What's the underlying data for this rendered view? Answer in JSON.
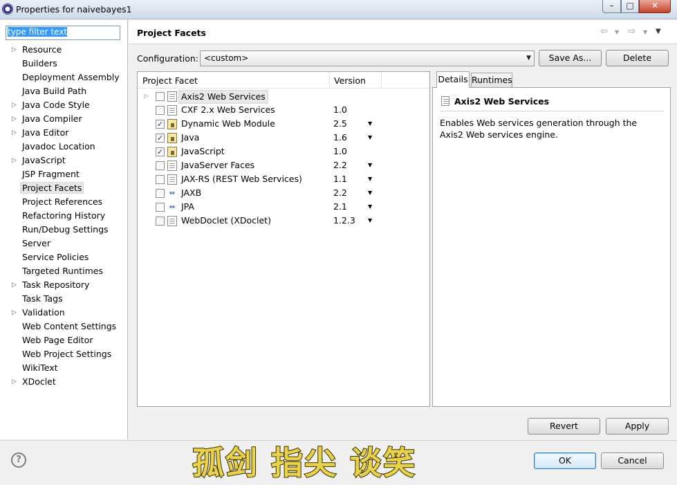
{
  "window": {
    "title": "Properties for naivebayes1",
    "controls": {
      "minimize": "–",
      "maximize": "□",
      "close": "✕"
    }
  },
  "filter": {
    "value": "type filter text"
  },
  "nav": {
    "items": [
      {
        "label": "Resource",
        "expandable": true
      },
      {
        "label": "Builders",
        "expandable": false
      },
      {
        "label": "Deployment Assembly",
        "expandable": false
      },
      {
        "label": "Java Build Path",
        "expandable": false
      },
      {
        "label": "Java Code Style",
        "expandable": true
      },
      {
        "label": "Java Compiler",
        "expandable": true
      },
      {
        "label": "Java Editor",
        "expandable": true
      },
      {
        "label": "Javadoc Location",
        "expandable": false
      },
      {
        "label": "JavaScript",
        "expandable": true
      },
      {
        "label": "JSP Fragment",
        "expandable": false
      },
      {
        "label": "Project Facets",
        "expandable": false,
        "selected": true
      },
      {
        "label": "Project References",
        "expandable": false
      },
      {
        "label": "Refactoring History",
        "expandable": false
      },
      {
        "label": "Run/Debug Settings",
        "expandable": false
      },
      {
        "label": "Server",
        "expandable": false
      },
      {
        "label": "Service Policies",
        "expandable": false
      },
      {
        "label": "Targeted Runtimes",
        "expandable": false
      },
      {
        "label": "Task Repository",
        "expandable": true
      },
      {
        "label": "Task Tags",
        "expandable": false
      },
      {
        "label": "Validation",
        "expandable": true
      },
      {
        "label": "Web Content Settings",
        "expandable": false
      },
      {
        "label": "Web Page Editor",
        "expandable": false
      },
      {
        "label": "Web Project Settings",
        "expandable": false
      },
      {
        "label": "WikiText",
        "expandable": false
      },
      {
        "label": "XDoclet",
        "expandable": true
      }
    ]
  },
  "page": {
    "title": "Project Facets",
    "configuration_label": "Configuration:",
    "configuration_value": "<custom>",
    "save_as_label": "Save As...",
    "delete_label": "Delete"
  },
  "facet_table": {
    "headers": {
      "facet": "Project Facet",
      "version": "Version"
    },
    "rows": [
      {
        "name": "Axis2 Web Services",
        "version": "",
        "checked": false,
        "icon": "page-icon",
        "expandable": true,
        "has_dropdown": false,
        "selected": true
      },
      {
        "name": "CXF 2.x Web Services",
        "version": "1.0",
        "checked": false,
        "icon": "page-icon",
        "has_dropdown": false
      },
      {
        "name": "Dynamic Web Module",
        "version": "2.5",
        "checked": true,
        "icon": "lock-page-icon",
        "has_dropdown": true
      },
      {
        "name": "Java",
        "version": "1.6",
        "checked": true,
        "icon": "lock-page-icon",
        "has_dropdown": true
      },
      {
        "name": "JavaScript",
        "version": "1.0",
        "checked": true,
        "icon": "lock-page-icon",
        "has_dropdown": false
      },
      {
        "name": "JavaServer Faces",
        "version": "2.2",
        "checked": false,
        "icon": "page-icon",
        "has_dropdown": true
      },
      {
        "name": "JAX-RS (REST Web Services)",
        "version": "1.1",
        "checked": false,
        "icon": "page-icon",
        "has_dropdown": true
      },
      {
        "name": "JAXB",
        "version": "2.2",
        "checked": false,
        "icon": "arrows-icon",
        "has_dropdown": true
      },
      {
        "name": "JPA",
        "version": "2.1",
        "checked": false,
        "icon": "arrows-icon",
        "has_dropdown": true
      },
      {
        "name": "WebDoclet (XDoclet)",
        "version": "1.2.3",
        "checked": false,
        "icon": "page-icon",
        "has_dropdown": true
      }
    ]
  },
  "details": {
    "tabs": [
      "Details",
      "Runtimes"
    ],
    "title": "Axis2 Web Services",
    "description": "Enables Web services generation through the Axis2 Web services engine."
  },
  "buttons": {
    "revert": "Revert",
    "apply": "Apply",
    "ok": "OK",
    "cancel": "Cancel",
    "help": "?"
  },
  "watermark": {
    "text": "孤剑  指尖  谈笑",
    "color": "#e8d24a"
  }
}
